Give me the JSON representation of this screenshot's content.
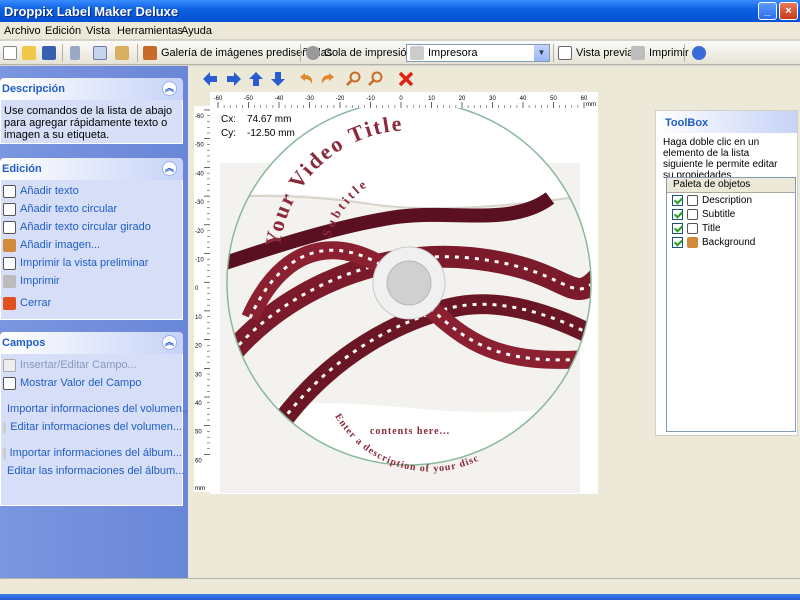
{
  "window": {
    "title": "Droppix Label Maker Deluxe"
  },
  "menu": [
    "Archivo",
    "Edición",
    "Vista",
    "Herramientas",
    "Ayuda"
  ],
  "toolbar": {
    "gallery": "Galería de imágenes prediseñadas",
    "queue": "Cola de impresión",
    "printer": "Impresora",
    "preview": "Vista previa",
    "print": "Imprimir"
  },
  "left": {
    "descripcion": {
      "title": "Descripción",
      "text": "Use comandos de la lista de abajo para agregar rápidamente texto o imagen a su etiqueta."
    },
    "edicion": {
      "title": "Edición",
      "items": [
        "Añadir texto",
        "Añadir texto circular",
        "Añadir texto circular girado",
        "Añadir imagen...",
        "Imprimir la vista preliminar",
        "Imprimir",
        "Cerrar"
      ]
    },
    "campos": {
      "title": "Campos",
      "items": [
        "Insertar/Editar Campo...",
        "Mostrar Valor del Campo",
        "Importar informaciones del volumen...",
        "Editar informaciones del volumen...",
        "Importar informaciones del álbum...",
        "Editar las informaciones del álbum..."
      ]
    }
  },
  "canvas": {
    "cx_label": "Cx:",
    "cx": "74.67 mm",
    "cy_label": "Cy:",
    "cy": "-12.50 mm",
    "unit": "mm",
    "title": "Your Video Title",
    "subtitle": "Subtitle",
    "description_line1": "Enter a description of your disc",
    "description_line2": "contents here...",
    "hticks": [
      "-60",
      "-50",
      "-40",
      "-30",
      "-20",
      "-10",
      "0",
      "10",
      "20",
      "30",
      "40",
      "50",
      "60"
    ],
    "vticks": [
      "-60",
      "-50",
      "-40",
      "-30",
      "-20",
      "-10",
      "0",
      "10",
      "20",
      "30",
      "40",
      "50",
      "60"
    ]
  },
  "toolbox": {
    "title": "ToolBox",
    "desc": "Haga doble clic en un elemento de la lista siguiente le permite editar su propiedades.",
    "palette_title": "Paleta de objetos",
    "objects": [
      "Description",
      "Subtitle",
      "Title",
      "Background"
    ]
  },
  "colors": {
    "accent": "#215dc6",
    "title_text": "#8a2a3a",
    "film": "#7a1a2a"
  }
}
